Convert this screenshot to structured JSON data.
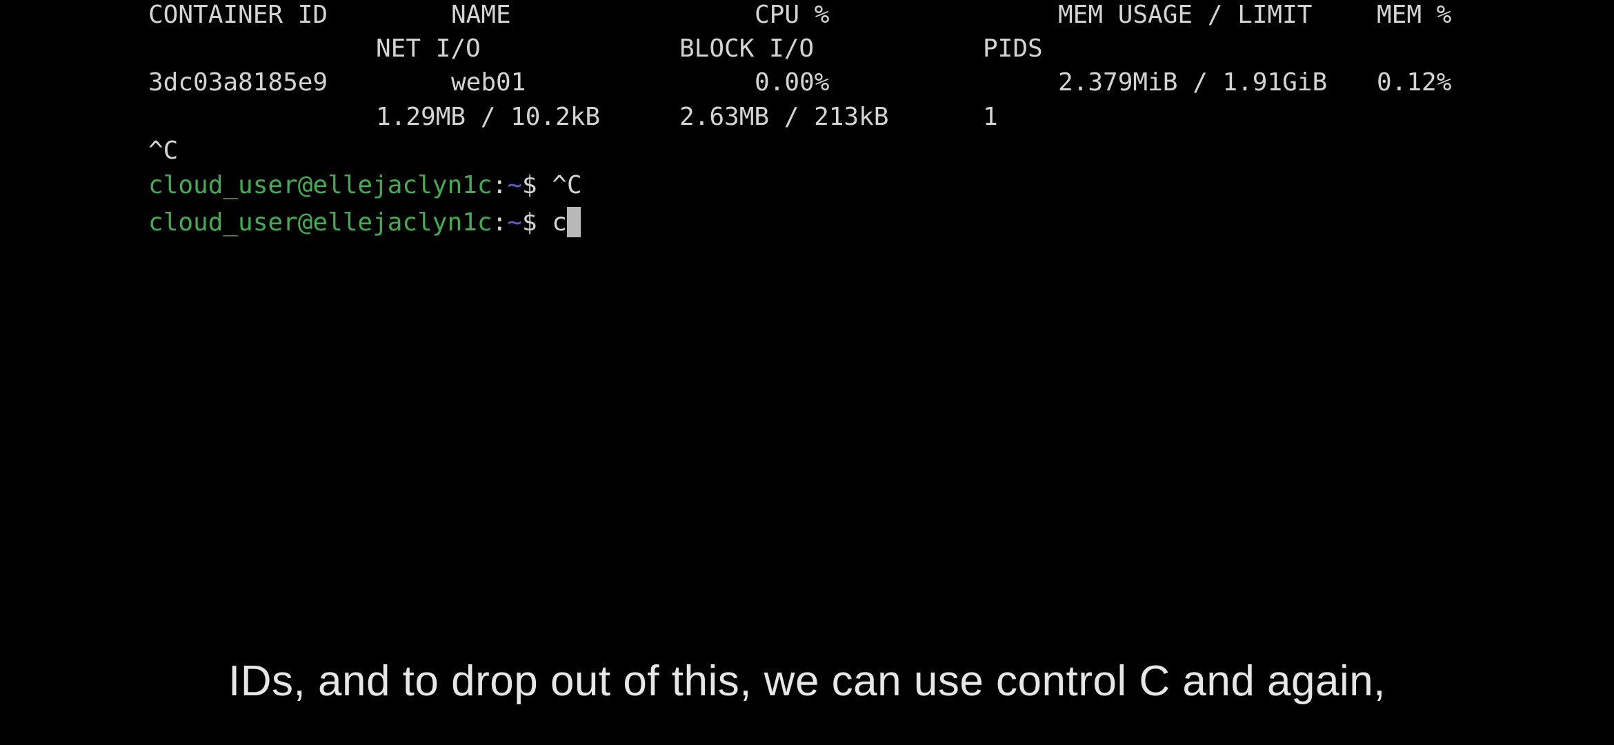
{
  "stats_header": {
    "container_id": "CONTAINER ID",
    "name": "NAME",
    "cpu": "CPU %",
    "mem_usage": "MEM USAGE / LIMIT",
    "mem_pct": "MEM %",
    "net_io": "NET I/O",
    "block_io": "BLOCK I/O",
    "pids": "PIDS"
  },
  "stats_row": {
    "container_id": "3dc03a8185e9",
    "name": "web01",
    "cpu": "0.00%",
    "mem_usage": "2.379MiB / 1.91GiB",
    "mem_pct": "0.12%",
    "net_io": "1.29MB / 10.2kB",
    "block_io": "2.63MB / 213kB",
    "pids": "1"
  },
  "interrupt_line": "^C",
  "prompts": [
    {
      "user_host": "cloud_user@ellejaclyn1c",
      "colon": ":",
      "path": "~",
      "symbol": "$ ",
      "command": "^C"
    },
    {
      "user_host": "cloud_user@ellejaclyn1c",
      "colon": ":",
      "path": "~",
      "symbol": "$ ",
      "command": "c"
    }
  ],
  "colors": {
    "background": "#000000",
    "text": "#d4d4d4",
    "user_host": "#3fae4d",
    "path": "#5a5fd6",
    "cursor": "#b8b8b8"
  },
  "subtitle": "IDs, and to drop out of this, we can use control C and again,"
}
